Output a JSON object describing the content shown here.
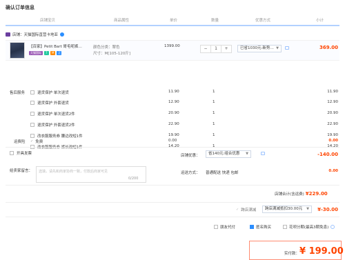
{
  "page": {
    "title": "确认订单信息"
  },
  "columns": [
    "店铺宝贝",
    "商品属性",
    "单价",
    "数量",
    "优惠方式",
    "小计"
  ],
  "store": {
    "label": "店铺：天猫国际直营卡地亚"
  },
  "item": {
    "name": "【百家】Petit Bart 哥毛呢裤…",
    "badges": [
      "天猫国际",
      "7",
      "M",
      "正"
    ],
    "attr_color": "颜色分类：翠色",
    "attr_size": "尺寸：M[105-120斤]",
    "price": "1399.00",
    "qty": "1",
    "qty_minus": "−",
    "qty_plus": "+",
    "discount": "已省1030元:新势…",
    "subtotal": "369.00"
  },
  "services": {
    "header": "售后服务",
    "rows": [
      {
        "label": "退货保护 单次退货",
        "price": "11.90",
        "qty": "1",
        "subtotal": "11.90"
      },
      {
        "label": "退货保护 外套退货",
        "price": "12.90",
        "qty": "1",
        "subtotal": "12.90"
      },
      {
        "label": "退货保护 单次退货2件",
        "price": "20.90",
        "qty": "1",
        "subtotal": "20.90"
      },
      {
        "label": "退货保护 外套退货2件",
        "price": "22.90",
        "qty": "1",
        "subtotal": "22.90"
      },
      {
        "label": "改衣服服务券 腰边改短1件",
        "price": "19.90",
        "qty": "1",
        "subtotal": "19.90"
      },
      {
        "label": "改衣服服务券 裤长改短1件",
        "price": "14.20",
        "qty": "1",
        "subtotal": "14.20"
      }
    ]
  },
  "shipping": {
    "label": "运费险",
    "value": "免费",
    "price": "0.00",
    "qty": "1",
    "subtotal": "0.00"
  },
  "invoice": {
    "label": "开具发票"
  },
  "store_discount": {
    "label": "店铺优惠：",
    "value": "省140元:组合优惠",
    "amount": "-140.00"
  },
  "message": {
    "label": "给卖家留言：",
    "placeholder": "选填，请先和商家协商一致，付款后商家可见",
    "count": "0/200"
  },
  "delivery": {
    "label": "运送方式：",
    "value": "普通配送 快递 包邮",
    "amount": "0.00"
  },
  "store_total": {
    "label": "店铺合计(含运费)",
    "amount": "¥229.00"
  },
  "tmall_coupon": {
    "label": "跨店满减",
    "value": "跨店满减抵扣30.00元",
    "amount": "¥-30.00"
  },
  "options": {
    "anonymous": "朋友代付",
    "points": "匿名购买",
    "installment": "花呗分期(最高3期免息)"
  },
  "final": {
    "label": "实付款：",
    "amount": "¥ 199.00"
  },
  "colors": {
    "accent": "#ff4400",
    "blue": "#2b8eff"
  }
}
